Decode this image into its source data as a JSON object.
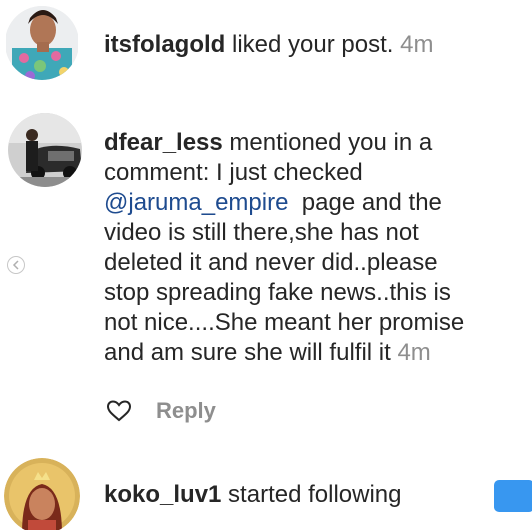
{
  "notifications": [
    {
      "username": "itsfolagold",
      "action": " liked your post.",
      "time": "4m"
    },
    {
      "username": "dfear_less",
      "lines": [
        " mentioned you in a",
        "comment: I just checked",
        "@jaruma_empire",
        "  page and the",
        "video is still there,she has not",
        "deleted it and never did..please",
        "stop spreading fake news..this is",
        "not nice....She meant her promise",
        "and am sure she will fulfil it"
      ],
      "time": "4m",
      "reply_label": "Reply"
    },
    {
      "username": "koko_luv1",
      "action": " started following"
    }
  ],
  "colors": {
    "text": "#262626",
    "muted": "#8e8e8e",
    "follow_button": "#3897f0"
  },
  "icons": {
    "reply": "heart-icon",
    "side": "chevron-left-icon"
  }
}
